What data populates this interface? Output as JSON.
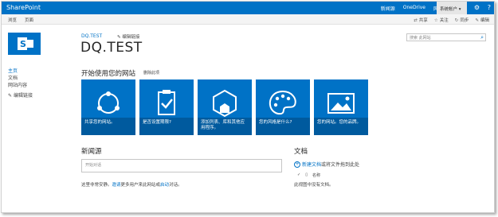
{
  "suite_bar": {
    "brand": "SharePoint",
    "links": [
      "新闻源",
      "OneDrive",
      "网站"
    ],
    "user": "系统帐户 ▾",
    "settings_icon": "gear-icon",
    "help_icon": "help-icon"
  },
  "ribbon": {
    "tabs": [
      "浏览",
      "页面"
    ],
    "actions": [
      "共享",
      "关注",
      "同步",
      "编辑"
    ]
  },
  "header": {
    "breadcrumb": "DQ.TEST",
    "edit_links": "编辑链接",
    "site_title": "DQ.TEST",
    "search_placeholder": "搜索 此网站"
  },
  "left_nav": {
    "items": [
      "主页",
      "文档",
      "网站内容"
    ],
    "edit_links": "编辑链接"
  },
  "getting_started": {
    "title": "开始使用您的网站",
    "remove": "删除此项",
    "tiles": [
      {
        "label": "共享您的网站。",
        "icon": "share-icon"
      },
      {
        "label": "是否设置期限?",
        "icon": "checklist-icon"
      },
      {
        "label": "添加列表、库和其他应用程序。",
        "icon": "apps-icon"
      },
      {
        "label": "您的风格是什么?",
        "icon": "palette-icon"
      },
      {
        "label": "您的网站。您的品牌。",
        "icon": "picture-icon"
      }
    ],
    "colors": {
      "tile": "#0072c6",
      "caption": "#005a9e"
    }
  },
  "newsfeed": {
    "title": "新闻源",
    "input_placeholder": "开始对话",
    "text_before": "这里非常安静。",
    "invite_link": "邀请",
    "text_middle": "更多用户来此网站或",
    "start_link": "启动",
    "text_after": "对话。"
  },
  "documents": {
    "title": "文档",
    "new_document": "新建文档",
    "new_tail": "或将文件拖到此处",
    "column_name": "名称",
    "empty": "此视图中没有文档。"
  }
}
